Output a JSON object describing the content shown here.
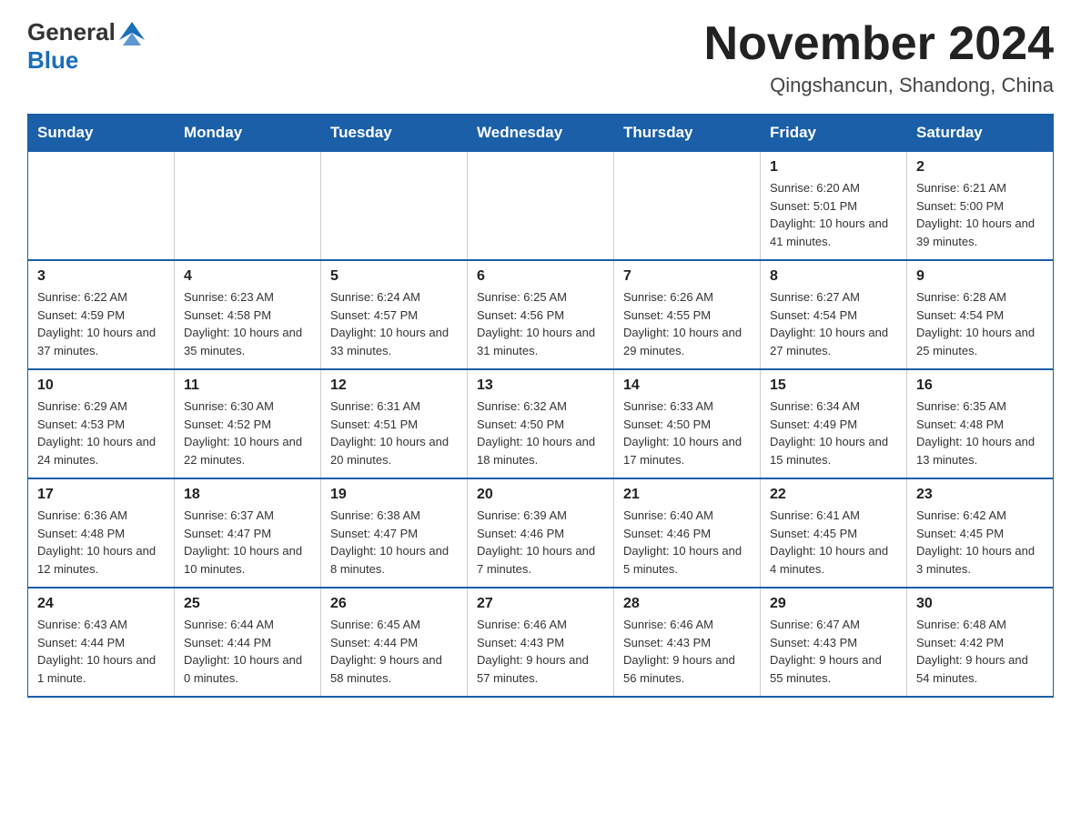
{
  "header": {
    "logo_general": "General",
    "logo_blue": "Blue",
    "month_title": "November 2024",
    "location": "Qingshancun, Shandong, China"
  },
  "weekdays": [
    "Sunday",
    "Monday",
    "Tuesday",
    "Wednesday",
    "Thursday",
    "Friday",
    "Saturday"
  ],
  "weeks": [
    [
      {
        "day": "",
        "info": ""
      },
      {
        "day": "",
        "info": ""
      },
      {
        "day": "",
        "info": ""
      },
      {
        "day": "",
        "info": ""
      },
      {
        "day": "",
        "info": ""
      },
      {
        "day": "1",
        "info": "Sunrise: 6:20 AM\nSunset: 5:01 PM\nDaylight: 10 hours and 41 minutes."
      },
      {
        "day": "2",
        "info": "Sunrise: 6:21 AM\nSunset: 5:00 PM\nDaylight: 10 hours and 39 minutes."
      }
    ],
    [
      {
        "day": "3",
        "info": "Sunrise: 6:22 AM\nSunset: 4:59 PM\nDaylight: 10 hours and 37 minutes."
      },
      {
        "day": "4",
        "info": "Sunrise: 6:23 AM\nSunset: 4:58 PM\nDaylight: 10 hours and 35 minutes."
      },
      {
        "day": "5",
        "info": "Sunrise: 6:24 AM\nSunset: 4:57 PM\nDaylight: 10 hours and 33 minutes."
      },
      {
        "day": "6",
        "info": "Sunrise: 6:25 AM\nSunset: 4:56 PM\nDaylight: 10 hours and 31 minutes."
      },
      {
        "day": "7",
        "info": "Sunrise: 6:26 AM\nSunset: 4:55 PM\nDaylight: 10 hours and 29 minutes."
      },
      {
        "day": "8",
        "info": "Sunrise: 6:27 AM\nSunset: 4:54 PM\nDaylight: 10 hours and 27 minutes."
      },
      {
        "day": "9",
        "info": "Sunrise: 6:28 AM\nSunset: 4:54 PM\nDaylight: 10 hours and 25 minutes."
      }
    ],
    [
      {
        "day": "10",
        "info": "Sunrise: 6:29 AM\nSunset: 4:53 PM\nDaylight: 10 hours and 24 minutes."
      },
      {
        "day": "11",
        "info": "Sunrise: 6:30 AM\nSunset: 4:52 PM\nDaylight: 10 hours and 22 minutes."
      },
      {
        "day": "12",
        "info": "Sunrise: 6:31 AM\nSunset: 4:51 PM\nDaylight: 10 hours and 20 minutes."
      },
      {
        "day": "13",
        "info": "Sunrise: 6:32 AM\nSunset: 4:50 PM\nDaylight: 10 hours and 18 minutes."
      },
      {
        "day": "14",
        "info": "Sunrise: 6:33 AM\nSunset: 4:50 PM\nDaylight: 10 hours and 17 minutes."
      },
      {
        "day": "15",
        "info": "Sunrise: 6:34 AM\nSunset: 4:49 PM\nDaylight: 10 hours and 15 minutes."
      },
      {
        "day": "16",
        "info": "Sunrise: 6:35 AM\nSunset: 4:48 PM\nDaylight: 10 hours and 13 minutes."
      }
    ],
    [
      {
        "day": "17",
        "info": "Sunrise: 6:36 AM\nSunset: 4:48 PM\nDaylight: 10 hours and 12 minutes."
      },
      {
        "day": "18",
        "info": "Sunrise: 6:37 AM\nSunset: 4:47 PM\nDaylight: 10 hours and 10 minutes."
      },
      {
        "day": "19",
        "info": "Sunrise: 6:38 AM\nSunset: 4:47 PM\nDaylight: 10 hours and 8 minutes."
      },
      {
        "day": "20",
        "info": "Sunrise: 6:39 AM\nSunset: 4:46 PM\nDaylight: 10 hours and 7 minutes."
      },
      {
        "day": "21",
        "info": "Sunrise: 6:40 AM\nSunset: 4:46 PM\nDaylight: 10 hours and 5 minutes."
      },
      {
        "day": "22",
        "info": "Sunrise: 6:41 AM\nSunset: 4:45 PM\nDaylight: 10 hours and 4 minutes."
      },
      {
        "day": "23",
        "info": "Sunrise: 6:42 AM\nSunset: 4:45 PM\nDaylight: 10 hours and 3 minutes."
      }
    ],
    [
      {
        "day": "24",
        "info": "Sunrise: 6:43 AM\nSunset: 4:44 PM\nDaylight: 10 hours and 1 minute."
      },
      {
        "day": "25",
        "info": "Sunrise: 6:44 AM\nSunset: 4:44 PM\nDaylight: 10 hours and 0 minutes."
      },
      {
        "day": "26",
        "info": "Sunrise: 6:45 AM\nSunset: 4:44 PM\nDaylight: 9 hours and 58 minutes."
      },
      {
        "day": "27",
        "info": "Sunrise: 6:46 AM\nSunset: 4:43 PM\nDaylight: 9 hours and 57 minutes."
      },
      {
        "day": "28",
        "info": "Sunrise: 6:46 AM\nSunset: 4:43 PM\nDaylight: 9 hours and 56 minutes."
      },
      {
        "day": "29",
        "info": "Sunrise: 6:47 AM\nSunset: 4:43 PM\nDaylight: 9 hours and 55 minutes."
      },
      {
        "day": "30",
        "info": "Sunrise: 6:48 AM\nSunset: 4:42 PM\nDaylight: 9 hours and 54 minutes."
      }
    ]
  ]
}
